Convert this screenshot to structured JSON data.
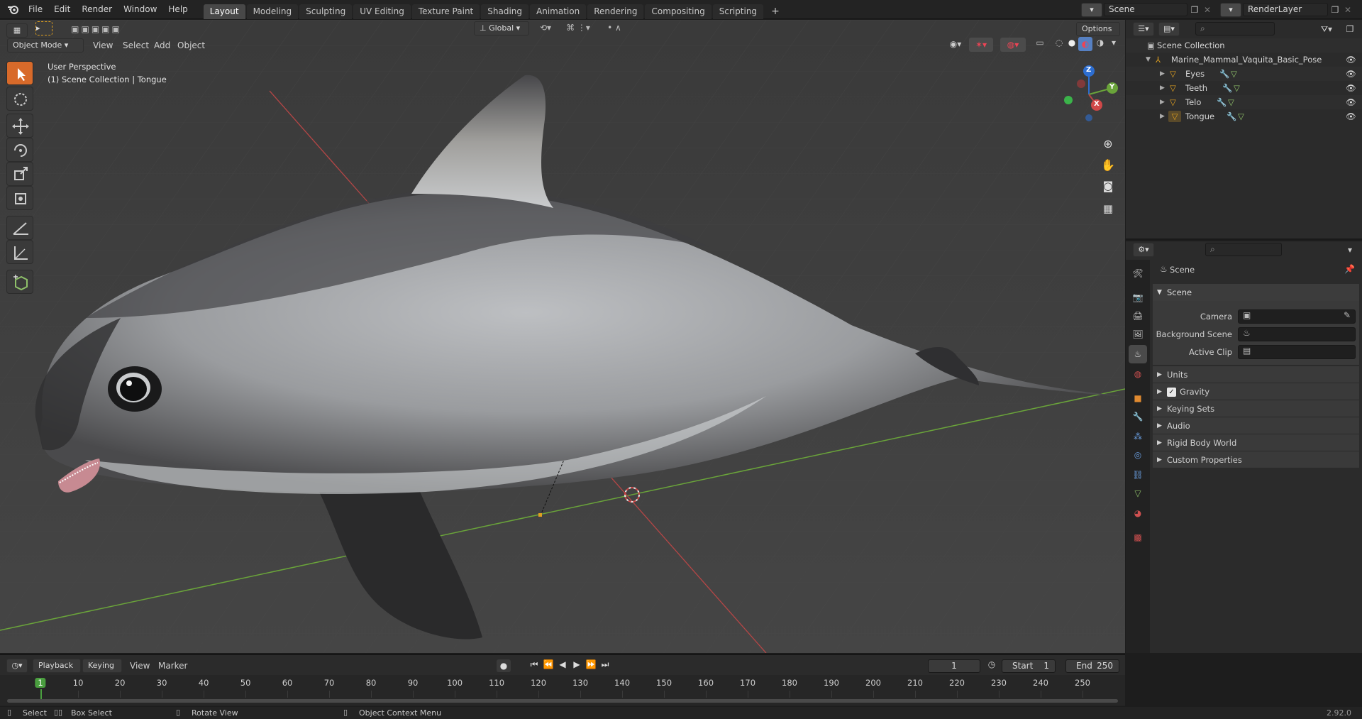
{
  "topbar": {
    "menus": [
      "File",
      "Edit",
      "Render",
      "Window",
      "Help"
    ],
    "workspaces": [
      "Layout",
      "Modeling",
      "Sculpting",
      "UV Editing",
      "Texture Paint",
      "Shading",
      "Animation",
      "Rendering",
      "Compositing",
      "Scripting"
    ],
    "active_workspace": "Layout",
    "add_tab": "+",
    "scene_name": "Scene",
    "view_layer": "RenderLayer"
  },
  "viewport": {
    "mode": "Object Mode",
    "menus": [
      "View",
      "Select",
      "Add",
      "Object"
    ],
    "transform_orientation": "Global",
    "options_label": "Options",
    "overlay_line1": "User Perspective",
    "overlay_line2": "(1) Scene Collection | Tongue",
    "gizmo": {
      "z": "Z",
      "y": "Y",
      "x": "X"
    },
    "tools": [
      "select-box",
      "cursor",
      "move",
      "rotate",
      "scale",
      "transform",
      "annotate",
      "measure",
      "add-cube"
    ]
  },
  "outliner": {
    "root": "Scene Collection",
    "armature": "Marine_Mammal_Vaquita_Basic_Pose",
    "children": [
      "Eyes",
      "Teeth",
      "Telo",
      "Tongue"
    ]
  },
  "properties": {
    "title": "Scene",
    "panel": "Scene",
    "camera_label": "Camera",
    "background_label": "Background Scene",
    "clip_label": "Active Clip",
    "subpanels": [
      "Units",
      "Gravity",
      "Keying Sets",
      "Audio",
      "Rigid Body World",
      "Custom Properties"
    ],
    "gravity_checked": true
  },
  "timeline": {
    "menus": [
      "Playback",
      "Keying",
      "View",
      "Marker"
    ],
    "current_frame": "1",
    "start_label": "Start",
    "start_value": "1",
    "end_label": "End",
    "end_value": "250",
    "ticks": [
      "1",
      "10",
      "20",
      "30",
      "40",
      "50",
      "60",
      "70",
      "80",
      "90",
      "100",
      "110",
      "120",
      "130",
      "140",
      "150",
      "160",
      "170",
      "180",
      "190",
      "200",
      "210",
      "220",
      "230",
      "240",
      "250"
    ]
  },
  "statusbar": {
    "select": "Select",
    "box_select": "Box Select",
    "rotate_view": "Rotate View",
    "context_menu": "Object Context Menu",
    "version": "2.92.0"
  },
  "colors": {
    "accent": "#5680c2",
    "active_frame": "#4a9e3f",
    "axis_x": "#b54646",
    "axis_y": "#6aa43a"
  }
}
